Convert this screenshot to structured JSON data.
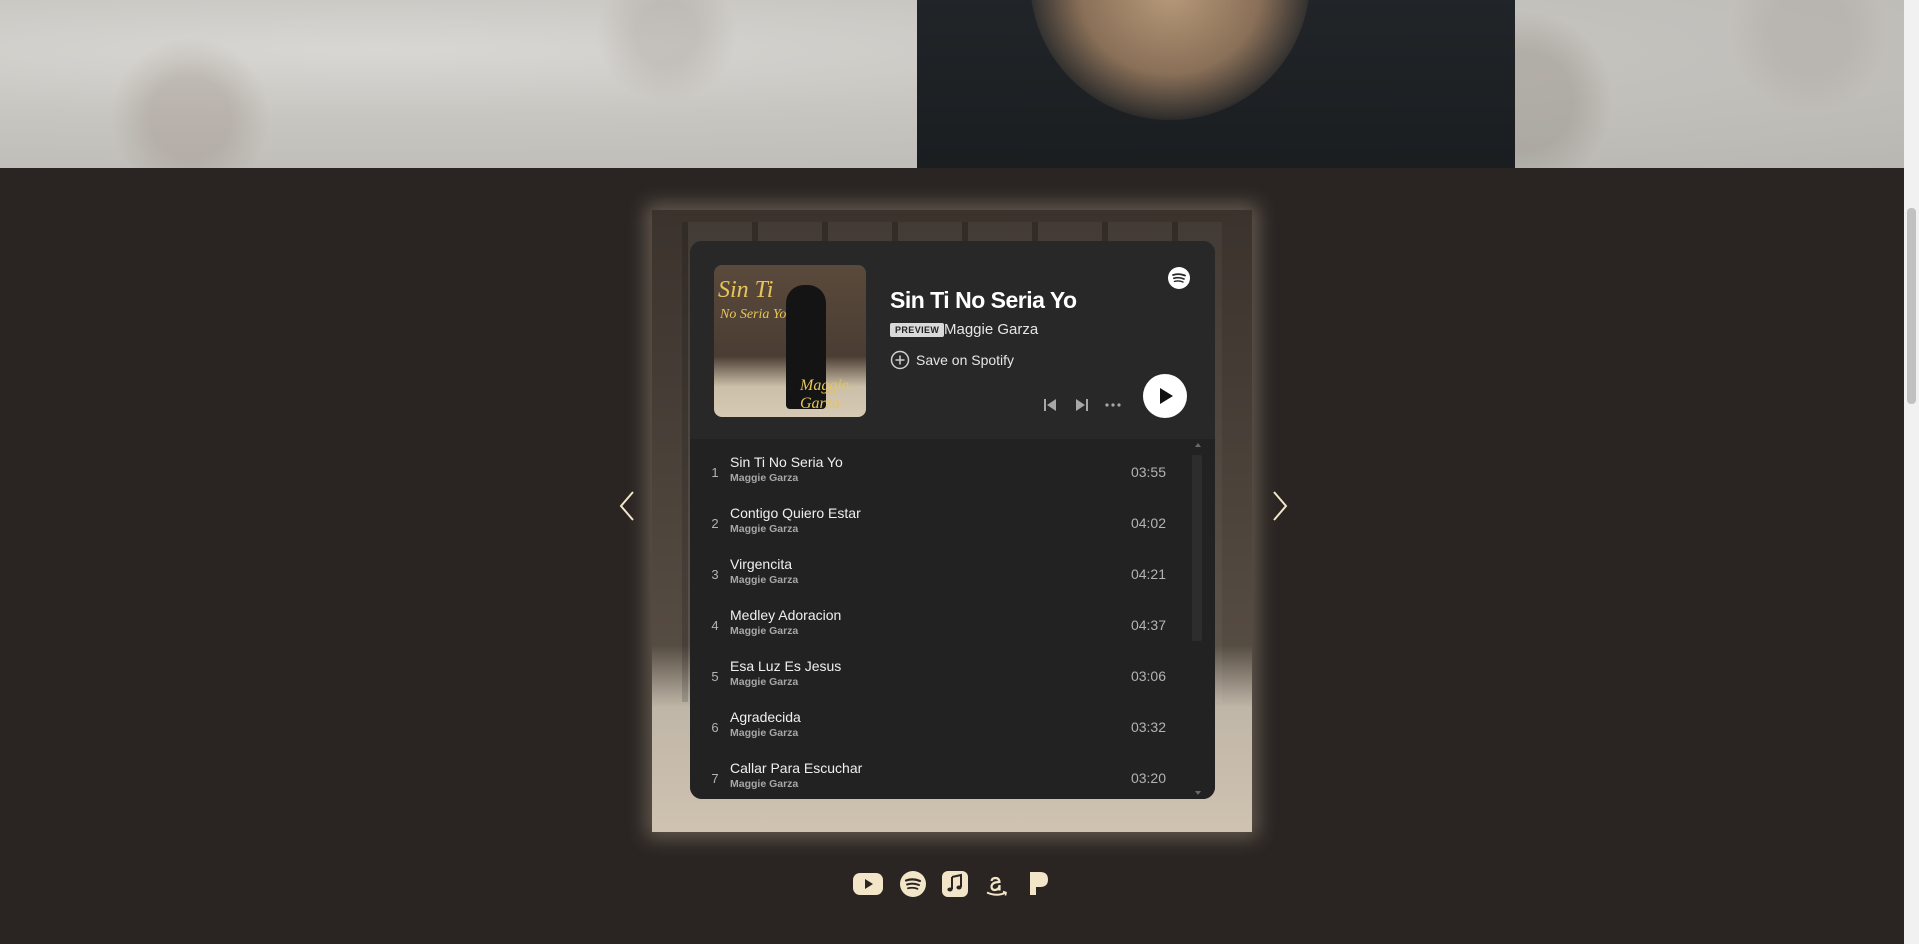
{
  "player": {
    "title": "Sin Ti No Seria Yo",
    "badge": "PREVIEW",
    "artist": "Maggie Garza",
    "save_label": "Save on Spotify",
    "cover": {
      "title": "Sin Ti",
      "subtitle": "No Seria Yo",
      "signature": "Maggie Garza"
    }
  },
  "tracks": [
    {
      "num": "1",
      "title": "Sin Ti No Seria Yo",
      "artist": "Maggie Garza",
      "duration": "03:55"
    },
    {
      "num": "2",
      "title": "Contigo Quiero Estar",
      "artist": "Maggie Garza",
      "duration": "04:02"
    },
    {
      "num": "3",
      "title": "Virgencita",
      "artist": "Maggie Garza",
      "duration": "04:21"
    },
    {
      "num": "4",
      "title": "Medley Adoracion",
      "artist": "Maggie Garza",
      "duration": "04:37"
    },
    {
      "num": "5",
      "title": "Esa Luz Es Jesus",
      "artist": "Maggie Garza",
      "duration": "03:06"
    },
    {
      "num": "6",
      "title": "Agradecida",
      "artist": "Maggie Garza",
      "duration": "03:32"
    },
    {
      "num": "7",
      "title": "Callar Para Escuchar",
      "artist": "Maggie Garza",
      "duration": "03:20"
    }
  ],
  "socials": [
    "youtube-icon",
    "spotify-icon",
    "apple-music-icon",
    "amazon-icon",
    "pandora-icon"
  ],
  "colors": {
    "page_bg": "#2a2523",
    "embed_bg": "#282828",
    "list_bg": "#222222",
    "social_icon": "#f3e6c8"
  }
}
